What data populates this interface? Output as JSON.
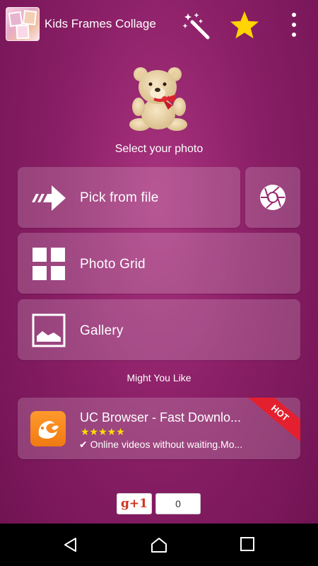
{
  "app": {
    "title": "Kids Frames Collage"
  },
  "toolbar": {
    "icons": [
      "magic-wand-icon",
      "star-icon",
      "more-vert-icon"
    ]
  },
  "main": {
    "prompt": "Select your photo",
    "options": [
      {
        "label": "Pick from file",
        "icon": "arrow-icon"
      },
      {
        "label": "Photo Grid",
        "icon": "grid-icon"
      },
      {
        "label": "Gallery",
        "icon": "gallery-icon"
      }
    ],
    "camera_icon": "camera-shutter-icon"
  },
  "recommend": {
    "heading": "Might You Like",
    "ad": {
      "title": "UC Browser - Fast Downlo...",
      "stars": "★★★★★",
      "description": "✔ Online videos without waiting.Mo...",
      "badge": "HOT"
    }
  },
  "social": {
    "plus_label": "g+1",
    "count": "0"
  },
  "colors": {
    "accent_star": "#ffd400",
    "background": "#8a1f66",
    "badge": "#e5202e",
    "uc_orange": "#f7891e"
  }
}
